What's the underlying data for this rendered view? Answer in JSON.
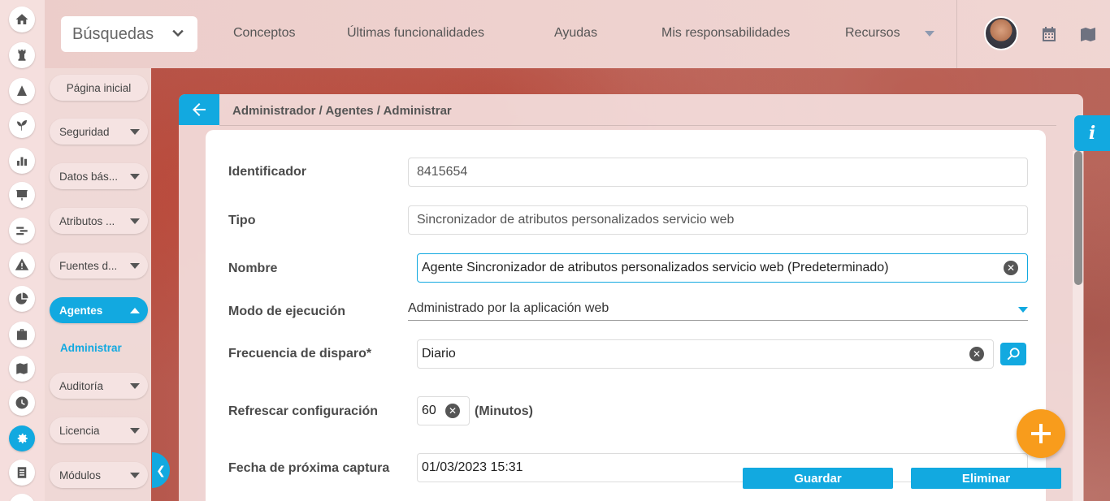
{
  "topbar": {
    "search_label": "Búsquedas",
    "nav": [
      "Conceptos",
      "Últimas funcionalidades",
      "Ayudas",
      "Mis responsabilidades",
      "Recursos"
    ]
  },
  "sidebar": {
    "items": [
      {
        "label": "Página inicial"
      },
      {
        "label": "Seguridad"
      },
      {
        "label": "Datos bás..."
      },
      {
        "label": "Atributos ..."
      },
      {
        "label": "Fuentes d..."
      },
      {
        "label": "Agentes"
      },
      {
        "label": "Auditoría"
      },
      {
        "label": "Licencia"
      },
      {
        "label": "Módulos"
      }
    ],
    "sub_item": "Administrar"
  },
  "breadcrumb": "Administrador / Agentes / Administrar",
  "info_label": "i",
  "form": {
    "identificador_label": "Identificador",
    "identificador_value": "8415654",
    "tipo_label": "Tipo",
    "tipo_value": "Sincronizador de atributos personalizados servicio web",
    "nombre_label": "Nombre",
    "nombre_value": "Agente Sincronizador de atributos personalizados servicio web (Predeterminado)",
    "modo_label": "Modo de ejecución",
    "modo_value": "Administrado por la aplicación web",
    "frecuencia_label": "Frecuencia de disparo*",
    "frecuencia_value": "Diario",
    "refrescar_label": "Refrescar configuración",
    "refrescar_value": "60",
    "refrescar_units": "(Minutos)",
    "fecha_label": "Fecha de próxima captura",
    "fecha_value": "01/03/2023 15:31"
  },
  "actions": {
    "save": "Guardar",
    "delete": "Eliminar"
  },
  "colors": {
    "accent": "#12a9e0",
    "fab": "#f89c1c"
  }
}
